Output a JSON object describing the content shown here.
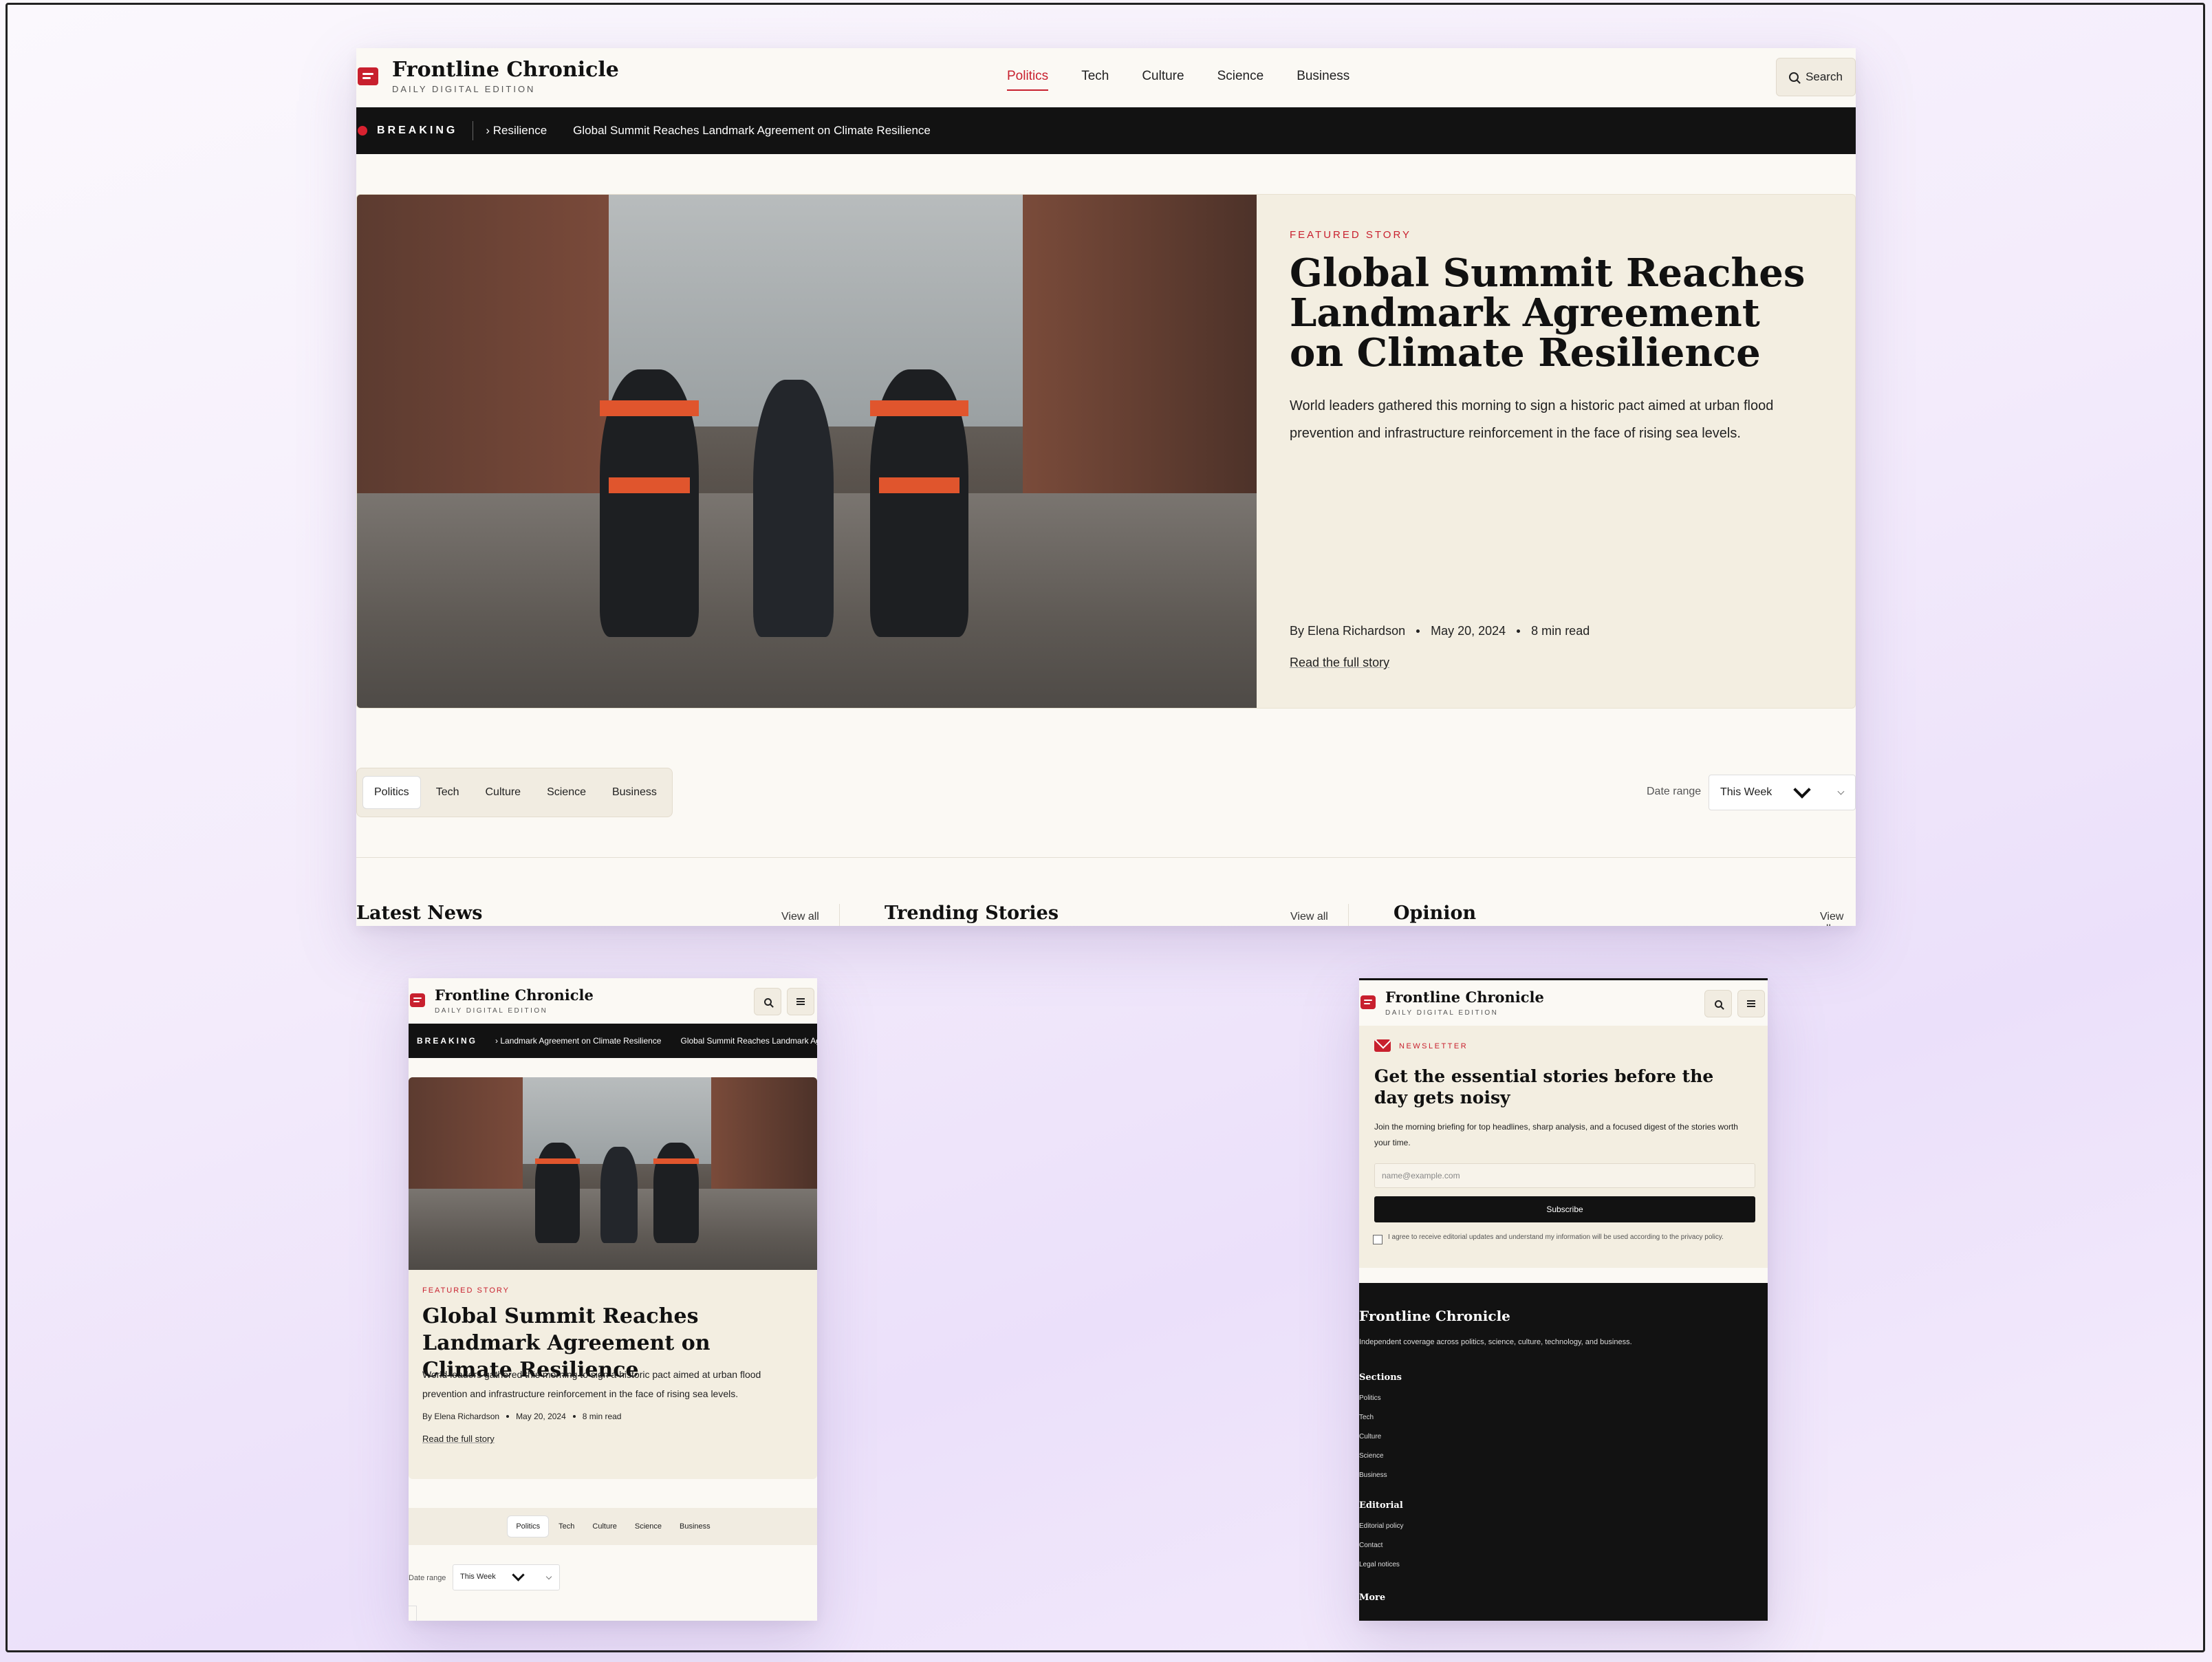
{
  "brand": {
    "name": "Frontline Chronicle",
    "tagline": "DAILY DIGITAL EDITION"
  },
  "nav": {
    "items": [
      "Politics",
      "Tech",
      "Culture",
      "Science",
      "Business"
    ],
    "active": "Politics",
    "search_label": "Search"
  },
  "breaking": {
    "label": "BREAKING",
    "desktop_items": [
      "Resilience",
      "Global Summit Reaches Landmark Agreement on Climate Resilience"
    ],
    "mobile_items": [
      "Landmark Agreement on Climate Resilience",
      "Global Summit Reaches Landmark Agreement on Climate Resilience"
    ]
  },
  "featured": {
    "kicker": "FEATURED STORY",
    "headline": "Global Summit Reaches Landmark Agreement on Climate Resilience",
    "dek": "World leaders gathered this morning to sign a historic pact aimed at urban flood prevention and infrastructure reinforcement in the face of rising sea levels.",
    "byline": "By Elena Richardson",
    "date": "May 20, 2024",
    "read_time": "8 min read",
    "read_link": "Read the full story",
    "image_icon": "firefighters-flood-photo"
  },
  "filters": {
    "categories": [
      "Politics",
      "Tech",
      "Culture",
      "Science",
      "Business"
    ],
    "active": "Politics",
    "date_range_label": "Date range",
    "date_range_value": "This Week"
  },
  "sections": [
    {
      "title": "Latest News",
      "view_all": "View all"
    },
    {
      "title": "Trending Stories",
      "view_all": "View all"
    },
    {
      "title": "Opinion",
      "view_all": "View all"
    }
  ],
  "newsletter": {
    "kicker": "NEWSLETTER",
    "headline": "Get the essential stories before the day gets noisy",
    "body": "Join the morning briefing for top headlines, sharp analysis, and a focused digest of the stories worth your time.",
    "email_placeholder": "name@example.com",
    "subscribe_label": "Subscribe",
    "consent": "I agree to receive editorial updates and understand my information will be used according to the privacy policy."
  },
  "footer": {
    "brand": "Frontline Chronicle",
    "description": "Independent coverage across politics, science, culture, technology, and business.",
    "sections_heading": "Sections",
    "sections_links": [
      "Politics",
      "Tech",
      "Culture",
      "Science",
      "Business"
    ],
    "editorial_heading": "Editorial",
    "editorial_links": [
      "Editorial policy",
      "Contact",
      "Legal notices"
    ],
    "more_heading": "More"
  },
  "colors": {
    "accent": "#c8202e",
    "ink": "#111111",
    "paper": "#fbf9f4",
    "card": "#f3eee1",
    "bar": "#121212"
  }
}
